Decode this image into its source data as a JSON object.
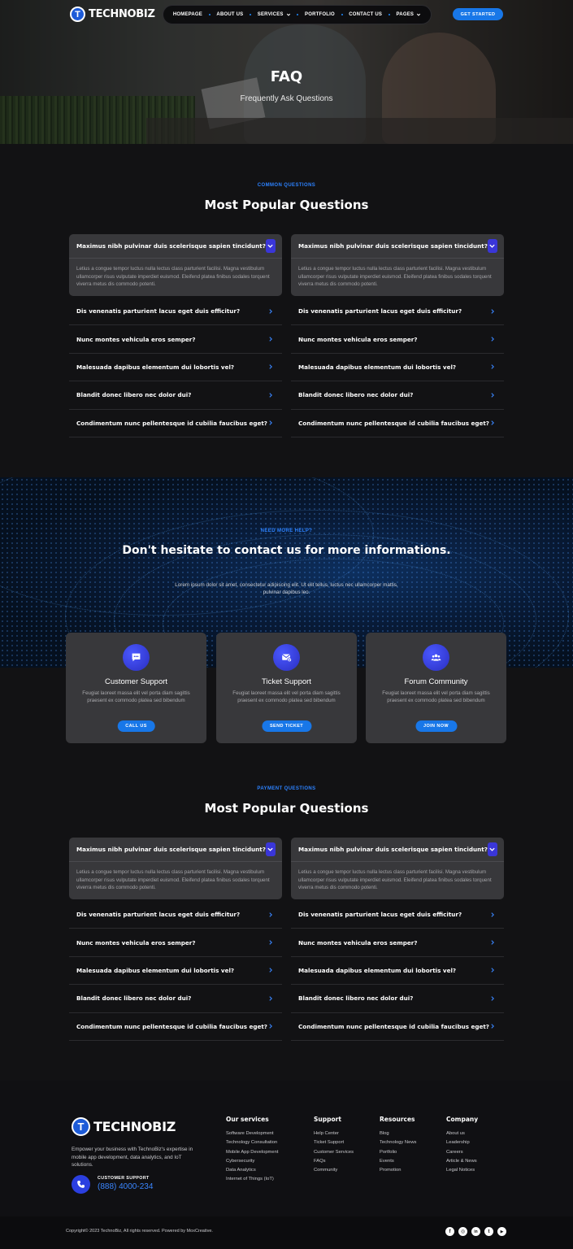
{
  "brand": {
    "name": "TECHNOBIZ",
    "logo_letter": "T"
  },
  "nav": {
    "items": [
      {
        "label": "HOMEPAGE"
      },
      {
        "label": "ABOUT US"
      },
      {
        "label": "SERVICES",
        "dropdown": true
      },
      {
        "label": "PORTFOLIO"
      },
      {
        "label": "CONTACT US"
      },
      {
        "label": "PAGES",
        "dropdown": true
      }
    ],
    "cta": "GET STARTED"
  },
  "hero": {
    "title": "FAQ",
    "subtitle": "Frequently Ask Questions"
  },
  "faq_common": {
    "eyebrow": "COMMON QUESTIONS",
    "title": "Most Popular Questions",
    "columns": [
      {
        "open": {
          "question": "Maximus nibh pulvinar duis scelerisque sapien tincidunt?",
          "answer": "Letius a congue tempor luctus nulla lectus class parturient facilisi. Magna vestibulum ullamcorper risus vulputate imperdiet euismod. Eleifend platea finibus sodales torquent viverra metus dis commodo potenti."
        },
        "items": [
          "Dis venenatis parturient lacus eget duis efficitur?",
          "Nunc montes vehicula eros semper?",
          "Malesuada dapibus elementum dui lobortis vel?",
          "Blandit donec libero nec dolor dui?",
          "Condimentum nunc pellentesque id cubilia faucibus eget?"
        ]
      },
      {
        "open": {
          "question": "Maximus nibh pulvinar duis scelerisque sapien tincidunt?",
          "answer": "Letius a congue tempor luctus nulla lectus class parturient facilisi. Magna vestibulum ullamcorper risus vulputate imperdiet euismod. Eleifend platea finibus sodales torquent viverra metus dis commodo potenti."
        },
        "items": [
          "Dis venenatis parturient lacus eget duis efficitur?",
          "Nunc montes vehicula eros semper?",
          "Malesuada dapibus elementum dui lobortis vel?",
          "Blandit donec libero nec dolor dui?",
          "Condimentum nunc pellentesque id cubilia faucibus eget?"
        ]
      }
    ]
  },
  "contact": {
    "eyebrow": "NEED MORE HELP?",
    "title": "Don't hesitate to contact us for more informations.",
    "text": "Lorem ipsum dolor sit amet, consectetur adipiscing elit. Ut elit tellus, luctus nec ullamcorper mattis, pulvinar dapibus leo.",
    "cards": [
      {
        "icon": "chat-icon",
        "title": "Customer Support",
        "text": "Feugiat laoreet massa elit vel porta diam sagittis praesent ex commodo platea sed bibendum",
        "button": "CALL US"
      },
      {
        "icon": "ticket-mail-icon",
        "title": "Ticket Support",
        "text": "Feugiat laoreet massa elit vel porta diam sagittis praesent ex commodo platea sed bibendum",
        "button": "SEND TICKET"
      },
      {
        "icon": "community-icon",
        "title": "Forum Community",
        "text": "Feugiat laoreet massa elit vel porta diam sagittis praesent ex commodo platea sed bibendum",
        "button": "JOIN NOW"
      }
    ]
  },
  "faq_payment": {
    "eyebrow": "PAYMENT QUESTIONS",
    "title": "Most Popular Questions",
    "columns": [
      {
        "open": {
          "question": "Maximus nibh pulvinar duis scelerisque sapien tincidunt?",
          "answer": "Letius a congue tempor luctus nulla lectus class parturient facilisi. Magna vestibulum ullamcorper risus vulputate imperdiet euismod. Eleifend platea finibus sodales torquent viverra metus dis commodo potenti."
        },
        "items": [
          "Dis venenatis parturient lacus eget duis efficitur?",
          "Nunc montes vehicula eros semper?",
          "Malesuada dapibus elementum dui lobortis vel?",
          "Blandit donec libero nec dolor dui?",
          "Condimentum nunc pellentesque id cubilia faucibus eget?"
        ]
      },
      {
        "open": {
          "question": "Maximus nibh pulvinar duis scelerisque sapien tincidunt?",
          "answer": "Letius a congue tempor luctus nulla lectus class parturient facilisi. Magna vestibulum ullamcorper risus vulputate imperdiet euismod. Eleifend platea finibus sodales torquent viverra metus dis commodo potenti."
        },
        "items": [
          "Dis venenatis parturient lacus eget duis efficitur?",
          "Nunc montes vehicula eros semper?",
          "Malesuada dapibus elementum dui lobortis vel?",
          "Blandit donec libero nec dolor dui?",
          "Condimentum nunc pellentesque id cubilia faucibus eget?"
        ]
      }
    ]
  },
  "footer": {
    "description": "Empower your business with TechnoBiz's expertise in mobile app development, data analytics, and IoT solutions.",
    "support_label": "CUSTOMER SUPPORT",
    "support_phone": "(888) 4000-234",
    "columns": [
      {
        "title": "Our services",
        "links": [
          "Software Development",
          "Technology Consultation",
          "Mobile App Development",
          "Cybersecurity",
          "Data Analytics",
          "Internet of Things (IoT)"
        ]
      },
      {
        "title": "Support",
        "links": [
          "Help Center",
          "Ticket Support",
          "Customer Services",
          "FAQs",
          "Community"
        ]
      },
      {
        "title": "Resources",
        "links": [
          "Blog",
          "Technology News",
          "Portfolio",
          "Events",
          "Promotion"
        ]
      },
      {
        "title": "Company",
        "links": [
          "About us",
          "Leadership",
          "Careers",
          "Article & News",
          "Legal Notices"
        ]
      }
    ],
    "copyright": "Copyright© 2023 TechnoBiz, All rights reserved. Powered by MoxCreative.",
    "social": [
      {
        "icon": "facebook-icon",
        "glyph": "f"
      },
      {
        "icon": "instagram-icon",
        "glyph": "◎"
      },
      {
        "icon": "linkedin-icon",
        "glyph": "in"
      },
      {
        "icon": "twitter-icon",
        "glyph": "t"
      },
      {
        "icon": "youtube-icon",
        "glyph": "▶"
      }
    ]
  },
  "colors": {
    "accent": "#1877e8",
    "toggle": "#3a36d8",
    "eyebrow": "#2c82ff",
    "background": "#121214",
    "card": "#38383b"
  }
}
